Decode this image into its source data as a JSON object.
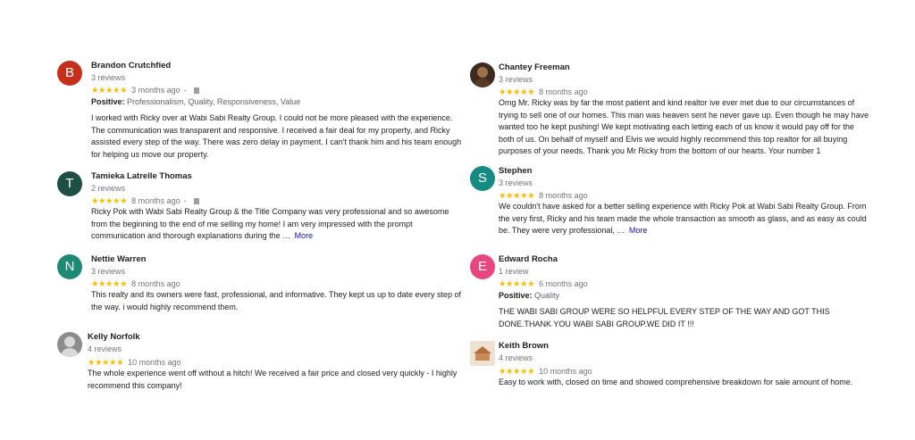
{
  "colors": {
    "star": "#fbbc04",
    "more_link": "#1a0dab"
  },
  "left_column": [
    {
      "name": "Brandon Crutchfied",
      "initial": "B",
      "avatar_color": "#c5301d",
      "review_count": "3 reviews",
      "stars": "★★★★★",
      "time": "3 months ago",
      "separator": "-",
      "has_flag": true,
      "positive_label": "Positive:",
      "positive_text": "Professionalism, Quality, Responsiveness, Value",
      "text_lines": [
        "I worked with Ricky over at Wabi Sabi Realty Group. I could not be more pleased with the experience.",
        "The communication was transparent and responsive. I received a fair deal for my property, and Ricky",
        "assisted every step of the way. There was zero delay in payment. I can't thank him and his team enough",
        "for helping us move our property."
      ]
    },
    {
      "name": "Tamieka Latrelle Thomas",
      "initial": "T",
      "avatar_color": "#1d4f45",
      "review_count": "2 reviews",
      "stars": "★★★★★",
      "time": "8 months ago",
      "separator": "-",
      "has_flag": true,
      "text_lines": [
        "Ricky Pok with Wabi Sabi Realty Group & the Title Company was very professional and so awesome",
        "from the beginning to the end of me selling my home! I am very impressed with the prompt",
        "communication and thorough explanations during the …"
      ],
      "more": "More"
    },
    {
      "name": "Nettie Warren",
      "initial": "N",
      "avatar_color": "#1d8a73",
      "review_count": "3 reviews",
      "stars": "★★★★★",
      "time": "8 months ago",
      "text_lines": [
        "This realty and its owners were fast, professional,  and informative. They kept us up to date every step of",
        "the way.  i would highly recommend them."
      ]
    },
    {
      "name": "Kelly Norfolk",
      "review_count": "4 reviews",
      "stars": "★★★★★",
      "time": "10 months ago",
      "text_lines": [
        "The whole experience went off without a hitch! We received a fair price and closed very quickly - I highly",
        "recommend this company!"
      ]
    }
  ],
  "right_column": [
    {
      "name": "Chantey Freeman",
      "review_count": "3 reviews",
      "stars": "★★★★★",
      "time": "8 months ago",
      "text_lines": [
        "Omg Mr. Ricky was by far the most patient and kind realtor ive ever met due to our circumstances of",
        "trying to sell one of our homes. This man was heaven sent he never gave up. Even though he may have",
        "wanted too he kept pushing! We kept motivating each letting each of us  know it would pay off for the",
        "both of us. On behalf of  myself and Elvis we would highly recommend this top realtor for all buying",
        "purposes of your needs. Thank you Mr Ricky from the bottom of our hearts. Your number 1"
      ]
    },
    {
      "name": "Stephen",
      "initial": "S",
      "avatar_color": "#158b82",
      "review_count": "3 reviews",
      "stars": "★★★★★",
      "time": "8 months ago",
      "text_lines": [
        "We couldn't have asked for a better selling experience with Ricky Pok at Wabi Sabi Realty Group.  From",
        "the very first, Ricky and his team made the whole transaction as smooth as glass, and as easy as could",
        "be.  They were very professional, …"
      ],
      "more": "More"
    },
    {
      "name": "Edward Rocha",
      "initial": "E",
      "avatar_color": "#e8467c",
      "review_count": "1 review",
      "stars": "★★★★★",
      "time": "6 months ago",
      "positive_label": "Positive:",
      "positive_text": "Quality",
      "text_lines": [
        "THE WABI SABI GROUP WERE SO HELPFUL EVERY STEP OF THE WAY AND GOT THIS",
        "DONE.THANK YOU WABI SABI GROUP.WE DID IT !!!"
      ]
    },
    {
      "name": "Keith Brown",
      "review_count": "4 reviews",
      "stars": "★★★★★",
      "time": "10 months ago",
      "text_lines": [
        "Easy to work with, closed on time and showed comprehensive breakdown for sale amount of home."
      ]
    }
  ]
}
